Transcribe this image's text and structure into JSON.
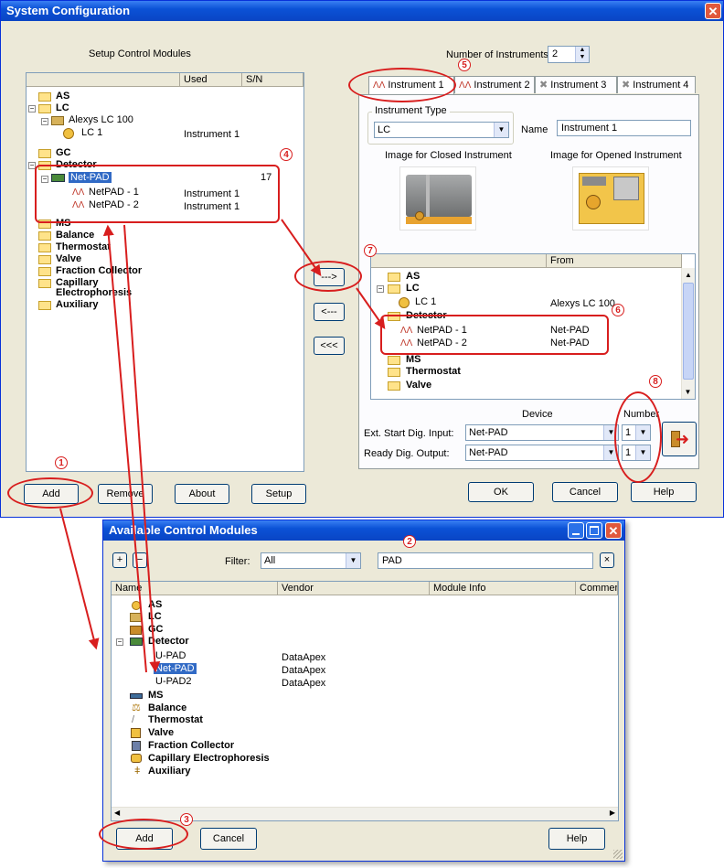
{
  "sysconf": {
    "title": "System Configuration",
    "setup_label": "Setup Control Modules",
    "columns": {
      "used": "Used",
      "sn": "S/N"
    },
    "tree": {
      "as": "AS",
      "lc": "LC",
      "alexys": "Alexys LC 100",
      "lc1": "LC 1",
      "lc1_used": "Instrument 1",
      "gc": "GC",
      "detector": "Detector",
      "netpad": "Net-PAD",
      "netpad_sn": "17",
      "netpad1": "NetPAD - 1",
      "netpad1_used": "Instrument 1",
      "netpad2": "NetPAD - 2",
      "netpad2_used": "Instrument 1",
      "ms": "MS",
      "balance": "Balance",
      "thermostat": "Thermostat",
      "valve": "Valve",
      "fraction": "Fraction Collector",
      "capillary1": "Capillary",
      "capillary2": "Electrophoresis",
      "auxiliary": "Auxiliary"
    },
    "num_instruments_label": "Number of Instruments:",
    "num_instruments_value": "2",
    "tabs": [
      "Instrument 1",
      "Instrument 2",
      "Instrument 3",
      "Instrument 4"
    ],
    "instrument_type_label": "Instrument Type",
    "instrument_type_value": "LC",
    "name_label": "Name",
    "name_value": "Instrument 1",
    "img_closed_label": "Image for Closed Instrument",
    "img_opened_label": "Image for Opened Instrument",
    "from_header": "From",
    "itree": {
      "as": "AS",
      "lc": "LC",
      "lc1": "LC 1",
      "lc1_from": "Alexys LC 100",
      "detector": "Detector",
      "np1": "NetPAD - 1",
      "np1_from": "Net-PAD",
      "np2": "NetPAD - 2",
      "np2_from": "Net-PAD",
      "ms": "MS",
      "thermostat": "Thermostat",
      "valve": "Valve"
    },
    "move_buttons": [
      "--->",
      "<---",
      "<<<"
    ],
    "device_label": "Device",
    "number_label": "Number",
    "ext_start_label": "Ext. Start Dig. Input:",
    "ext_start_value": "Net-PAD",
    "ext_start_num": "1",
    "ready_label": "Ready Dig. Output:",
    "ready_value": "Net-PAD",
    "ready_num": "1",
    "buttons": {
      "add": "Add",
      "remove": "Remove",
      "about": "About",
      "setup": "Setup",
      "ok": "OK",
      "cancel": "Cancel",
      "help": "Help"
    }
  },
  "acm": {
    "title": "Available Control Modules",
    "filter_label": "Filter:",
    "filter_value": "All",
    "search_value": "PAD",
    "columns": {
      "name": "Name",
      "vendor": "Vendor",
      "module_info": "Module Info",
      "comment": "Commer"
    },
    "tree": {
      "as": "AS",
      "lc": "LC",
      "gc": "GC",
      "detector": "Detector",
      "upad": "U-PAD",
      "upad_vendor": "DataApex",
      "netpad": "Net-PAD",
      "netpad_vendor": "DataApex",
      "upad2": "U-PAD2",
      "upad2_vendor": "DataApex",
      "ms": "MS",
      "balance": "Balance",
      "thermostat": "Thermostat",
      "valve": "Valve",
      "fraction": "Fraction Collector",
      "capillary": "Capillary Electrophoresis",
      "auxiliary": "Auxiliary"
    },
    "buttons": {
      "add": "Add",
      "cancel": "Cancel",
      "help": "Help",
      "plus": "+",
      "minus": "−",
      "clear": "×"
    }
  },
  "callouts": [
    "1",
    "2",
    "3",
    "4",
    "5",
    "6",
    "7",
    "8"
  ],
  "colors": {
    "annotation": "#d81e1e",
    "titlebar": "#0b52d6",
    "selection": "#316ac5"
  }
}
